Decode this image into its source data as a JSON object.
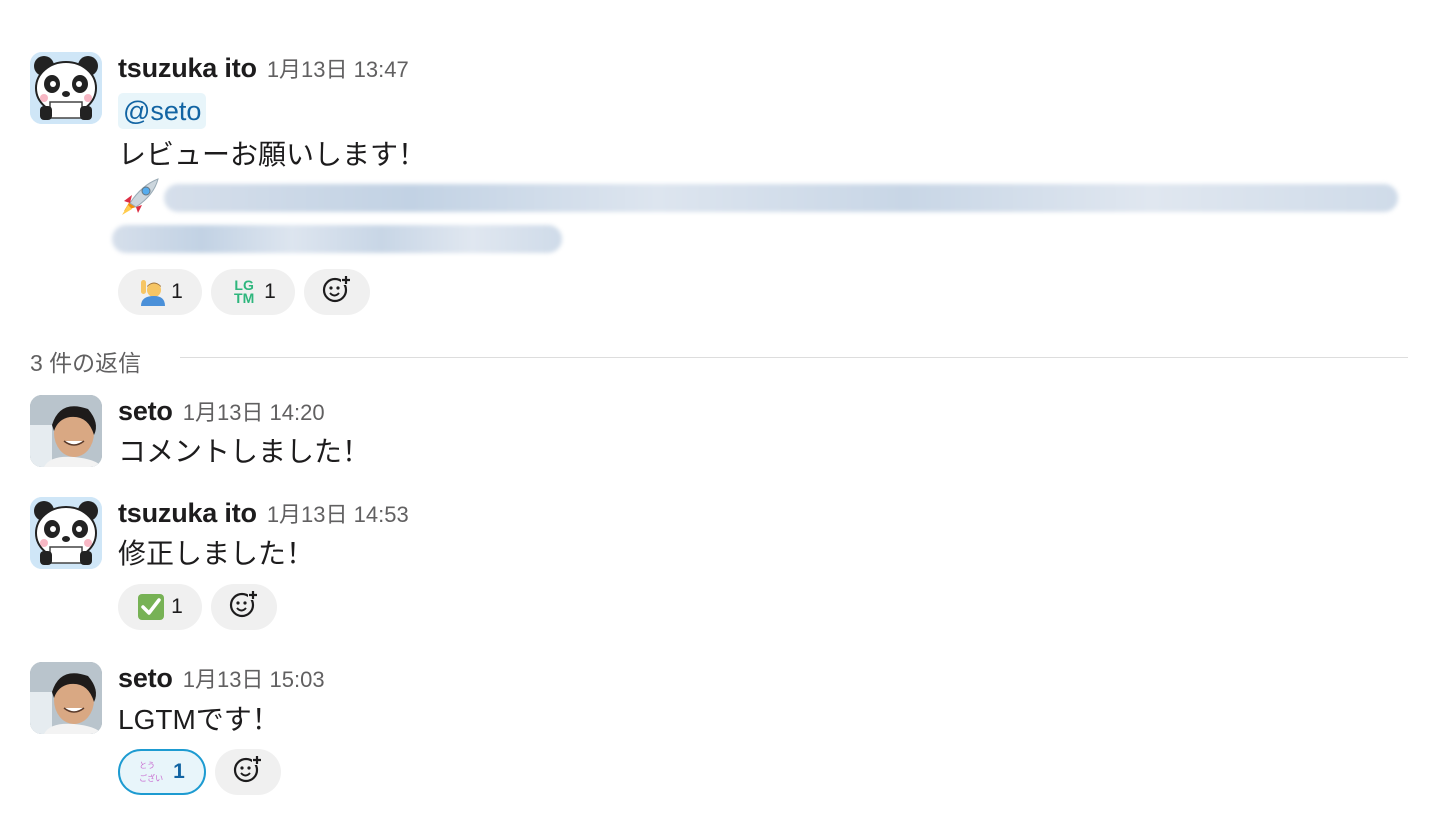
{
  "parent_message": {
    "author": "tsuzuka ito",
    "timestamp": "1月13日 13:47",
    "mention": "@seto",
    "text": "レビューお願いします！",
    "link_icon": "rocket-icon",
    "reactions": [
      {
        "icon": "person-raising-hand-icon",
        "count": "1"
      },
      {
        "icon": "lgtm-icon",
        "count": "1",
        "icon_text_top": "LG",
        "icon_text_bottom": "TM"
      }
    ]
  },
  "thread": {
    "reply_count_label": "3 件の返信"
  },
  "replies": [
    {
      "author": "seto",
      "timestamp": "1月13日 14:20",
      "text": "コメントしました！"
    },
    {
      "author": "tsuzuka ito",
      "timestamp": "1月13日 14:53",
      "text": "修正しました！",
      "reactions": [
        {
          "icon": "check-mark-button-icon",
          "count": "1"
        }
      ]
    },
    {
      "author": "seto",
      "timestamp": "1月13日 15:03",
      "text": "LGTMです！",
      "reactions": [
        {
          "icon": "arigatou-gozaimasu-icon",
          "count": "1",
          "icon_text_top": "ありがとう",
          "icon_text_bottom": "ございます"
        }
      ]
    }
  ],
  "colors": {
    "mention": "#1264a3",
    "mention_bg": "#e8f5fa",
    "active_reaction_border": "#1d9bd1",
    "lgtm": "#2eb67d"
  }
}
